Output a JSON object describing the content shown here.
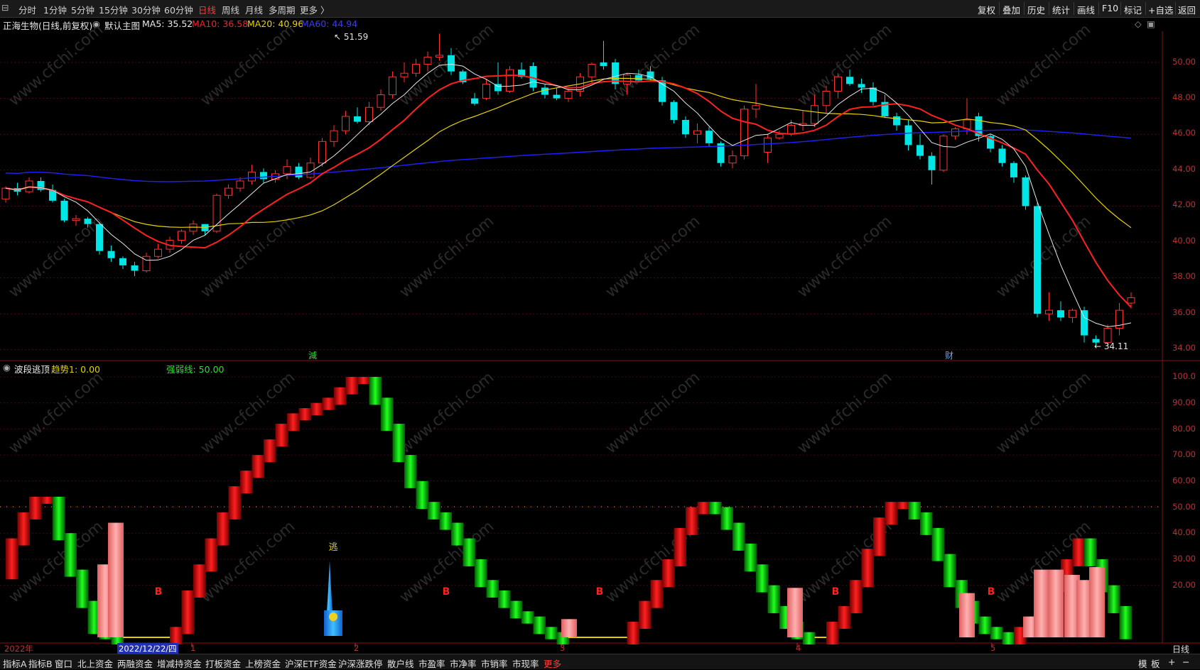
{
  "toolbar": {
    "periods": [
      "分时",
      "1分钟",
      "5分钟",
      "15分钟",
      "30分钟",
      "60分钟",
      "日线",
      "周线",
      "月线",
      "多周期",
      "更多 〉"
    ],
    "active_period": "日线",
    "right_buttons": [
      "复权",
      "叠加",
      "历史",
      "统计",
      "画线",
      "F10",
      "标记",
      "+自选",
      "返回"
    ]
  },
  "stock": {
    "title": "正海生物(日线,前复权)",
    "main_chart_label": "默认主图",
    "ma5": "MA5: 35.52",
    "ma10": "MA10: 36.58",
    "ma20": "MA20: 40.96",
    "ma60": "MA60: 44.94",
    "high_label": "51.59",
    "low_label": "34.11",
    "marker_1": "減",
    "marker_2": "财"
  },
  "indicator": {
    "name": "波段逃顶",
    "trend": "趋势1: 0.00",
    "strong_weak": "强弱线: 50.00",
    "escape_label": "逃",
    "buy_label": "B"
  },
  "price_axis": [
    "50.00",
    "48.00",
    "46.00",
    "44.00",
    "42.00",
    "40.00",
    "38.00",
    "36.00",
    "34.00"
  ],
  "ind_axis": [
    "100.0",
    "90.00",
    "80.00",
    "70.00",
    "60.00",
    "50.00",
    "40.00",
    "30.00",
    "20.00"
  ],
  "time_axis": {
    "year": "2022年",
    "cursor_date": "2022/12/22/四",
    "months": [
      "1",
      "2",
      "3",
      "4",
      "5"
    ],
    "right_label": "日线"
  },
  "bottombar": {
    "tabs": [
      "指标A",
      "指标B",
      "窗口",
      "北上资金",
      "两融资金",
      "增减持资金",
      "打板资金",
      "上榜资金",
      "沪深ETF资金",
      "沪深涨跌停",
      "散户线",
      "市盈率",
      "市净率",
      "市销率",
      "市现率",
      "更多"
    ],
    "right": [
      "模",
      "板",
      "+",
      "−"
    ]
  },
  "colors": {
    "up": "#ff3030",
    "down": "#00e5e5",
    "ma5": "#e8e8e8",
    "ma10": "#ff2020",
    "ma20": "#e6d200",
    "ma60": "#2020ff",
    "axis": "#a01818"
  }
}
